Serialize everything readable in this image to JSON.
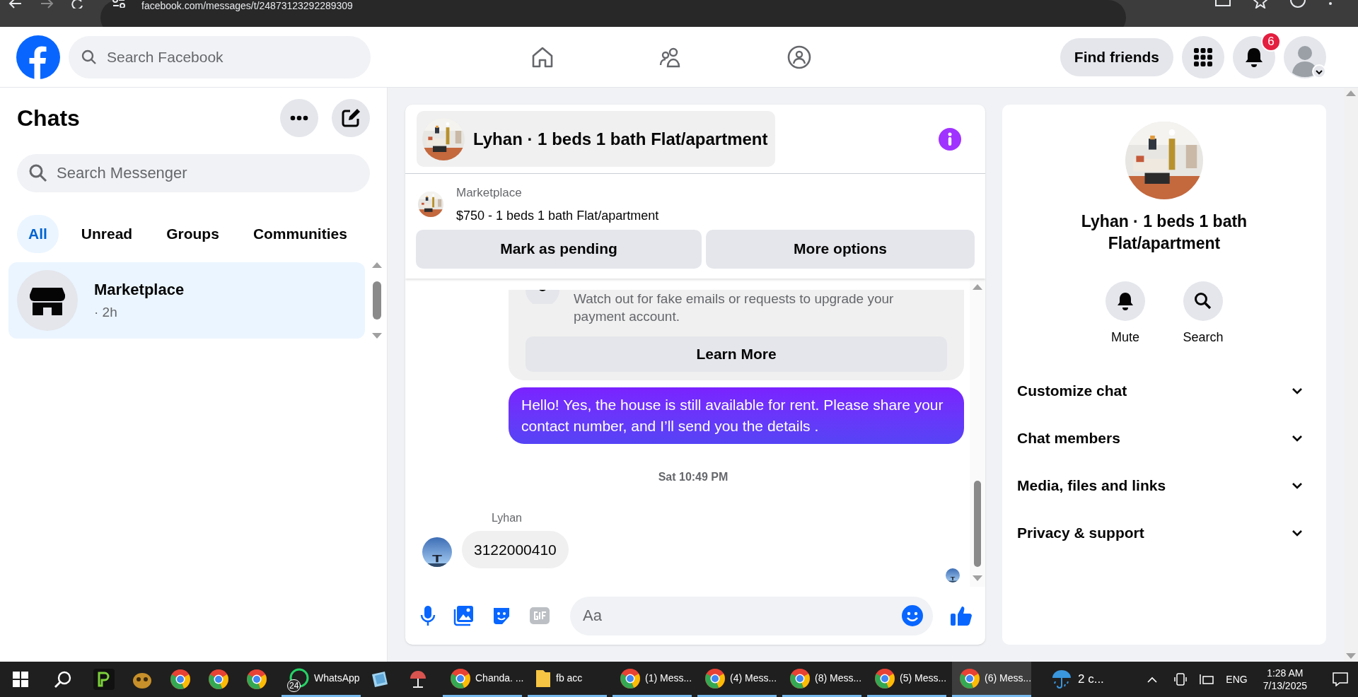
{
  "browser": {
    "url": "facebook.com/messages/t/24873123292289309"
  },
  "topbar": {
    "search_placeholder": "Search Facebook",
    "find_friends": "Find friends",
    "notification_count": "6"
  },
  "sidebar": {
    "title": "Chats",
    "search_placeholder": "Search Messenger",
    "filters": [
      {
        "label": "All",
        "selected": true
      },
      {
        "label": "Unread",
        "selected": false
      },
      {
        "label": "Groups",
        "selected": false
      },
      {
        "label": "Communities",
        "selected": false
      }
    ],
    "chats": [
      {
        "name": "Marketplace",
        "meta": "· 2h",
        "selected": true
      }
    ]
  },
  "conversation": {
    "title": "Lyhan · 1 beds 1 bath Flat/apartment",
    "listing": {
      "source": "Marketplace",
      "title": "$750 - 1 beds 1 bath Flat/apartment"
    },
    "actions": [
      "Mark as pending",
      "More options"
    ],
    "messages": [
      {
        "kind": "notice",
        "text": "Watch out for fake emails or requests to upgrade your payment account.",
        "button": "Learn More"
      },
      {
        "kind": "outgoing",
        "text": "Hello! Yes, the house is still available for rent. Please share your contact number, and I’ll send you the details ."
      },
      {
        "kind": "timestamp",
        "text": "Sat 10:49 PM"
      },
      {
        "kind": "incoming",
        "sender": "Lyhan",
        "text": "3122000410"
      }
    ],
    "composer_placeholder": "Aa"
  },
  "details": {
    "title": "Lyhan · 1 beds 1 bath Flat/apartment",
    "actions": [
      "Mute",
      "Search"
    ],
    "sections": [
      "Customize chat",
      "Chat members",
      "Media, files and links",
      "Privacy & support"
    ]
  },
  "taskbar": {
    "apps": [
      {
        "kind": "icon"
      },
      {
        "kind": "icon"
      },
      {
        "kind": "icon"
      },
      {
        "kind": "icon"
      },
      {
        "kind": "icon"
      },
      {
        "kind": "labeled",
        "label": "WhatsApp",
        "badge": "24",
        "selected": false
      },
      {
        "kind": "icon"
      },
      {
        "kind": "icon"
      },
      {
        "kind": "labeled",
        "label": "Chanda. ...",
        "selected": false
      },
      {
        "kind": "labeled",
        "label": "fb acc",
        "selected": false
      },
      {
        "kind": "labeled",
        "label": "(1) Mess...",
        "selected": false
      },
      {
        "kind": "labeled",
        "label": "(4) Mess...",
        "selected": false
      },
      {
        "kind": "labeled",
        "label": "(8) Mess...",
        "selected": false
      },
      {
        "kind": "labeled",
        "label": "(5) Mess...",
        "selected": false
      },
      {
        "kind": "labeled",
        "label": "(6) Mess...",
        "selected": true
      }
    ],
    "weather": "2 c...",
    "language": "ENG",
    "time": "1:28 AM",
    "date": "7/13/2025"
  }
}
